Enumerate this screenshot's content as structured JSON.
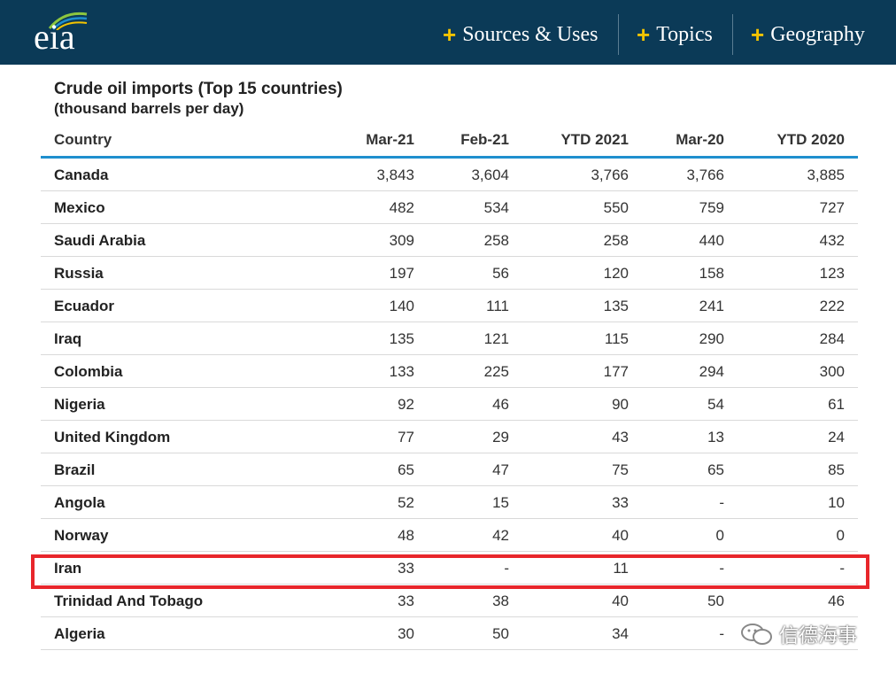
{
  "header": {
    "logo_text": "eia",
    "nav": [
      {
        "label": "Sources & Uses"
      },
      {
        "label": "Topics"
      },
      {
        "label": "Geography"
      }
    ],
    "colors": {
      "bar": "#0b3a57",
      "plus": "#f3c300"
    }
  },
  "table": {
    "title": "Crude oil imports (Top 15 countries)",
    "subtitle": "(thousand barrels per day)",
    "columns": [
      "Country",
      "Mar-21",
      "Feb-21",
      "YTD 2021",
      "Mar-20",
      "YTD 2020"
    ],
    "rows": [
      [
        "Canada",
        "3,843",
        "3,604",
        "3,766",
        "3,766",
        "3,885"
      ],
      [
        "Mexico",
        "482",
        "534",
        "550",
        "759",
        "727"
      ],
      [
        "Saudi Arabia",
        "309",
        "258",
        "258",
        "440",
        "432"
      ],
      [
        "Russia",
        "197",
        "56",
        "120",
        "158",
        "123"
      ],
      [
        "Ecuador",
        "140",
        "111",
        "135",
        "241",
        "222"
      ],
      [
        "Iraq",
        "135",
        "121",
        "115",
        "290",
        "284"
      ],
      [
        "Colombia",
        "133",
        "225",
        "177",
        "294",
        "300"
      ],
      [
        "Nigeria",
        "92",
        "46",
        "90",
        "54",
        "61"
      ],
      [
        "United Kingdom",
        "77",
        "29",
        "43",
        "13",
        "24"
      ],
      [
        "Brazil",
        "65",
        "47",
        "75",
        "65",
        "85"
      ],
      [
        "Angola",
        "52",
        "15",
        "33",
        "-",
        "10"
      ],
      [
        "Norway",
        "48",
        "42",
        "40",
        "0",
        "0"
      ],
      [
        "Iran",
        "33",
        "-",
        "11",
        "-",
        "-"
      ],
      [
        "Trinidad And Tobago",
        "33",
        "38",
        "40",
        "50",
        "46"
      ],
      [
        "Algeria",
        "30",
        "50",
        "34",
        "-",
        "-"
      ]
    ],
    "highlighted_row": "Iran",
    "colors": {
      "rule": "#1f8fce",
      "highlight": "#e8262b"
    }
  },
  "watermark": {
    "text": "信德海事"
  }
}
